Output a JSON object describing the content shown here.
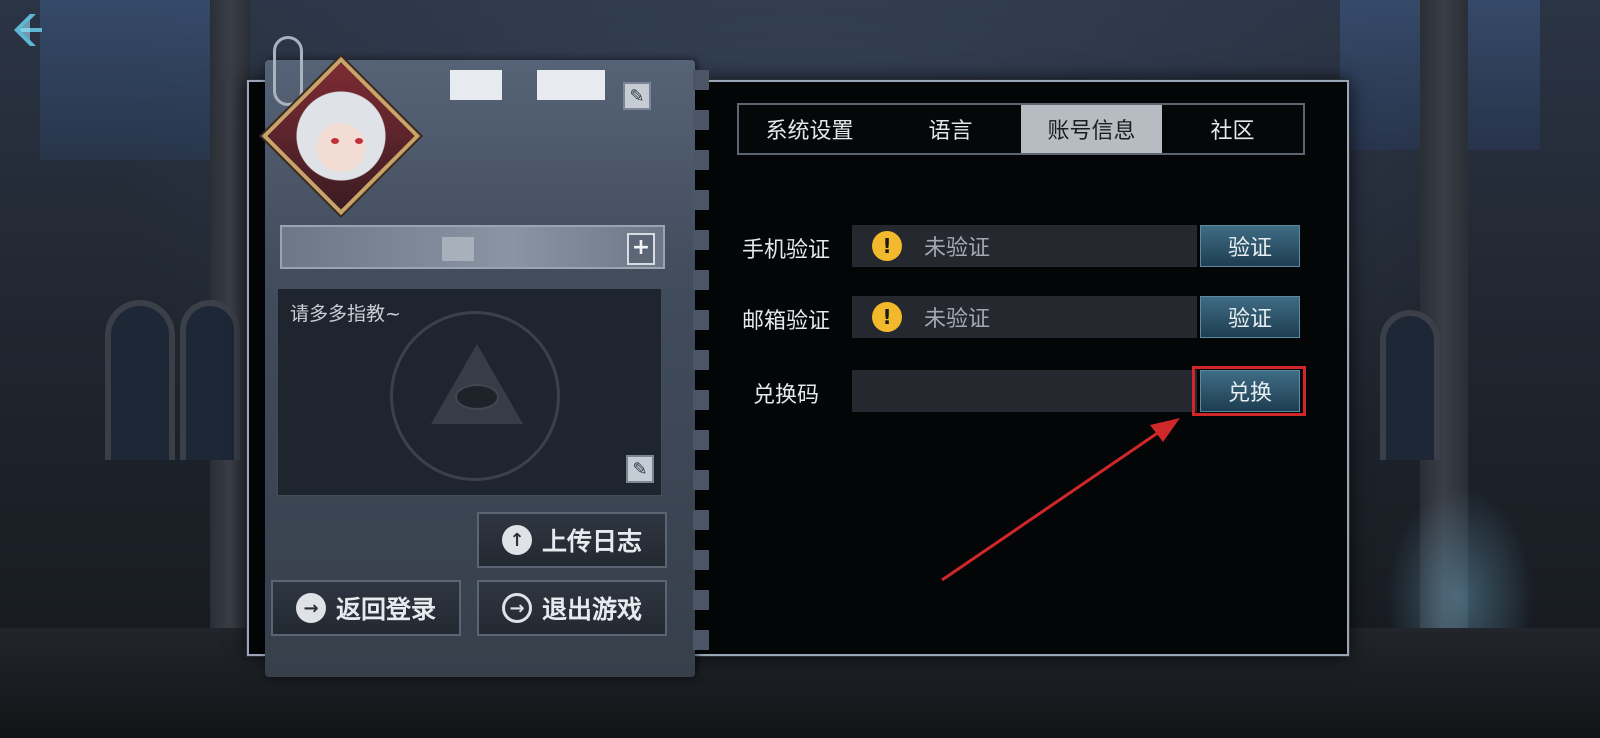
{
  "profile": {
    "signature": "请多多指教~"
  },
  "buttons": {
    "upload_log": "上传日志",
    "return_login": "返回登录",
    "exit_game": "退出游戏"
  },
  "tabs": [
    {
      "label": "系统设置",
      "active": false
    },
    {
      "label": "语言",
      "active": false
    },
    {
      "label": "账号信息",
      "active": true
    },
    {
      "label": "社区",
      "active": false
    }
  ],
  "account": {
    "phone": {
      "label": "手机验证",
      "status": "未验证",
      "button": "验证"
    },
    "email": {
      "label": "邮箱验证",
      "status": "未验证",
      "button": "验证"
    },
    "redeem": {
      "label": "兑换码",
      "value": "",
      "button": "兑换"
    }
  },
  "colors": {
    "highlight": "#d0272a",
    "warning": "#f1b92b",
    "active_tab": "#b7bcc3"
  },
  "icons": {
    "back": "chevron-left-icon",
    "edit": "edit-icon",
    "add": "plus-icon",
    "upload": "upload-arrow-icon",
    "return": "arrow-right-icon",
    "exit": "exit-icon",
    "warning": "exclamation-icon"
  }
}
